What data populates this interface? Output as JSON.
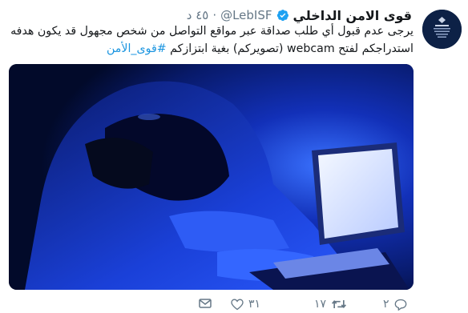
{
  "tweet": {
    "display_name": "قوى الامن الداخلي",
    "handle": "@LebISF",
    "separator": "·",
    "time": "٤٥ د",
    "text_line1": "يرجى عدم قبول أي طلب صداقة عبر مواقع التواصل من شخص مجهول قد يكون هدفه",
    "text_line2_part1": "استدراجكم لفتح webcam (تصويركم) بغية ابتزازكم ",
    "hashtag": "#قوى_الأمن"
  },
  "actions": {
    "reply_count": "٢",
    "retweet_count": "١٧",
    "like_count": "٣١"
  },
  "icons": {
    "verified": "verified-badge-icon",
    "reply": "reply-icon",
    "retweet": "retweet-icon",
    "like": "heart-icon",
    "dm": "envelope-icon"
  },
  "colors": {
    "link": "#1b95e0",
    "verified": "#1da1f2",
    "muted": "#657786"
  }
}
